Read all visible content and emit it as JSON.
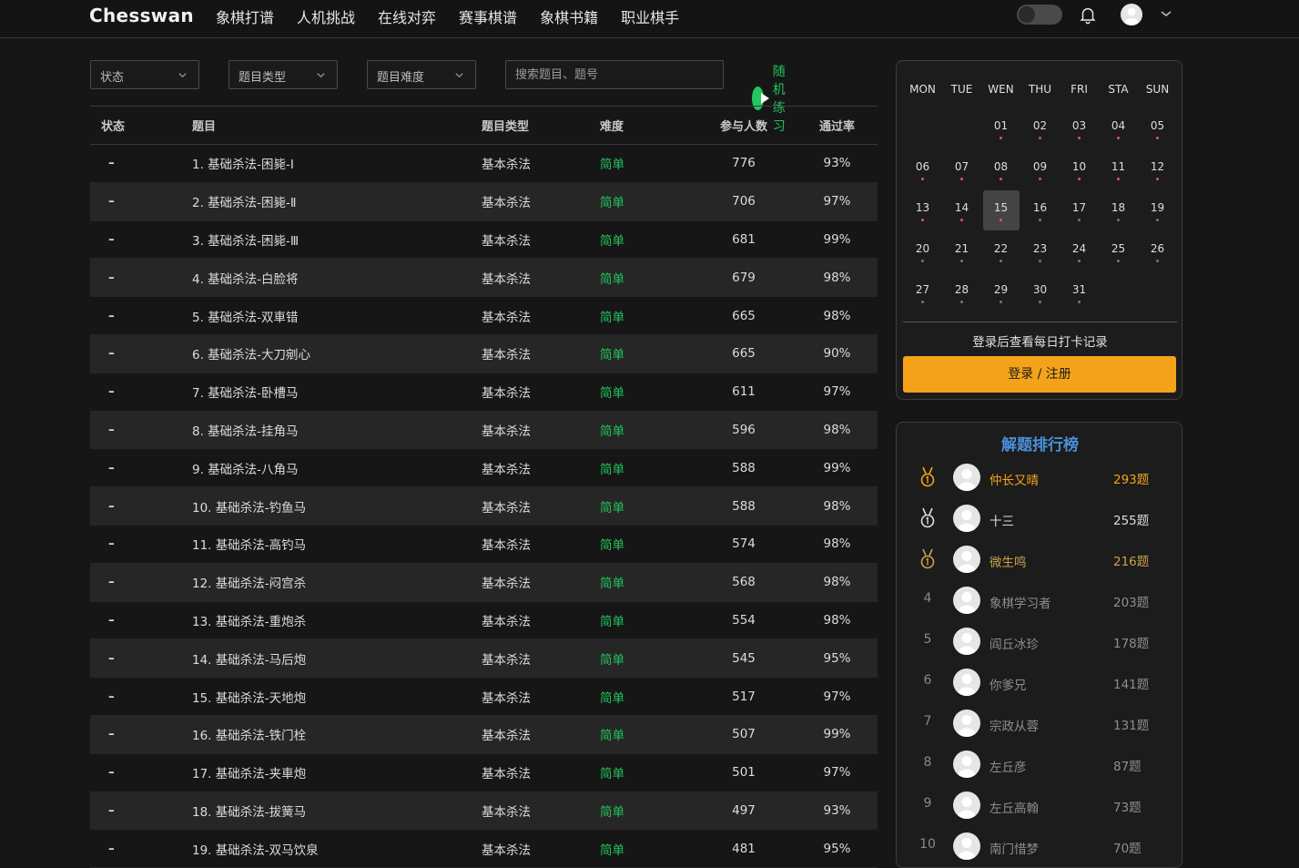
{
  "brand": "Chesswan",
  "nav": [
    "象棋打谱",
    "人机挑战",
    "在线对弈",
    "赛事棋谱",
    "象棋书籍",
    "职业棋手"
  ],
  "filters": {
    "status": "状态",
    "type": "题目类型",
    "difficulty": "题目难度",
    "search_placeholder": "搜索题目、题号",
    "random": "随机练习"
  },
  "table": {
    "headers": [
      "状态",
      "题目",
      "题目类型",
      "难度",
      "参与人数",
      "通过率"
    ],
    "rows": [
      [
        "–",
        "1. 基础杀法-困毙-Ⅰ",
        "基本杀法",
        "简单",
        "776",
        "93%"
      ],
      [
        "–",
        "2. 基础杀法-困毙-Ⅱ",
        "基本杀法",
        "简单",
        "706",
        "97%"
      ],
      [
        "–",
        "3. 基础杀法-困毙-Ⅲ",
        "基本杀法",
        "简单",
        "681",
        "99%"
      ],
      [
        "–",
        "4. 基础杀法-白脸将",
        "基本杀法",
        "简单",
        "679",
        "98%"
      ],
      [
        "–",
        "5. 基础杀法-双車错",
        "基本杀法",
        "简单",
        "665",
        "98%"
      ],
      [
        "–",
        "6. 基础杀法-大刀剜心",
        "基本杀法",
        "简单",
        "665",
        "90%"
      ],
      [
        "–",
        "7. 基础杀法-卧槽马",
        "基本杀法",
        "简单",
        "611",
        "97%"
      ],
      [
        "–",
        "8. 基础杀法-挂角马",
        "基本杀法",
        "简单",
        "596",
        "98%"
      ],
      [
        "–",
        "9. 基础杀法-八角马",
        "基本杀法",
        "简单",
        "588",
        "99%"
      ],
      [
        "–",
        "10. 基础杀法-钓鱼马",
        "基本杀法",
        "简单",
        "588",
        "98%"
      ],
      [
        "–",
        "11. 基础杀法-高钓马",
        "基本杀法",
        "简单",
        "574",
        "98%"
      ],
      [
        "–",
        "12. 基础杀法-闷宫杀",
        "基本杀法",
        "简单",
        "568",
        "98%"
      ],
      [
        "–",
        "13. 基础杀法-重炮杀",
        "基本杀法",
        "简单",
        "554",
        "98%"
      ],
      [
        "–",
        "14. 基础杀法-马后炮",
        "基本杀法",
        "简单",
        "545",
        "95%"
      ],
      [
        "–",
        "15. 基础杀法-天地炮",
        "基本杀法",
        "简单",
        "517",
        "97%"
      ],
      [
        "–",
        "16. 基础杀法-铁门栓",
        "基本杀法",
        "简单",
        "507",
        "99%"
      ],
      [
        "–",
        "17. 基础杀法-夹車炮",
        "基本杀法",
        "简单",
        "501",
        "97%"
      ],
      [
        "–",
        "18. 基础杀法-拔簧马",
        "基本杀法",
        "简单",
        "497",
        "93%"
      ],
      [
        "–",
        "19. 基础杀法-双马饮泉",
        "基本杀法",
        "简单",
        "481",
        "95%"
      ]
    ]
  },
  "calendar": {
    "weekdays": [
      "MON",
      "TUE",
      "WEN",
      "THU",
      "FRI",
      "STA",
      "SUN"
    ],
    "first_weekday_index": 2,
    "days": [
      "01",
      "02",
      "03",
      "04",
      "05",
      "06",
      "07",
      "08",
      "09",
      "10",
      "11",
      "12",
      "13",
      "14",
      "15",
      "16",
      "17",
      "18",
      "19",
      "20",
      "21",
      "22",
      "23",
      "24",
      "25",
      "26",
      "27",
      "28",
      "29",
      "30",
      "31"
    ],
    "today": "15",
    "marked_until": "15",
    "note": "登录后查看每日打卡记录",
    "login": "登录 / 注册"
  },
  "ranking": {
    "title": "解题排行榜",
    "items": [
      {
        "rank": "1",
        "name": "仲长又晴",
        "score": "293题",
        "color": "#f5a21b"
      },
      {
        "rank": "2",
        "name": "十三",
        "score": "255题",
        "color": "#dcdcdc"
      },
      {
        "rank": "3",
        "name": "微生鸣",
        "score": "216题",
        "color": "#c9a24a"
      },
      {
        "rank": "4",
        "name": "象棋学习者",
        "score": "203题",
        "color": "#8e8e8e"
      },
      {
        "rank": "5",
        "name": "阎丘冰珍",
        "score": "178题",
        "color": "#8e8e8e"
      },
      {
        "rank": "6",
        "name": "你爹兄",
        "score": "141题",
        "color": "#8e8e8e"
      },
      {
        "rank": "7",
        "name": "宗政从蓉",
        "score": "131题",
        "color": "#8e8e8e"
      },
      {
        "rank": "8",
        "name": "左丘彦",
        "score": "87题",
        "color": "#8e8e8e"
      },
      {
        "rank": "9",
        "name": "左丘高翰",
        "score": "73题",
        "color": "#8e8e8e"
      },
      {
        "rank": "10",
        "name": "南门惜梦",
        "score": "70题",
        "color": "#8e8e8e"
      }
    ]
  },
  "colors": {
    "accent_green": "#22c55e",
    "accent_orange": "#f5a21b",
    "title_blue": "#4a90d9",
    "dot_red": "#e05555",
    "dot_gray": "#777777"
  }
}
